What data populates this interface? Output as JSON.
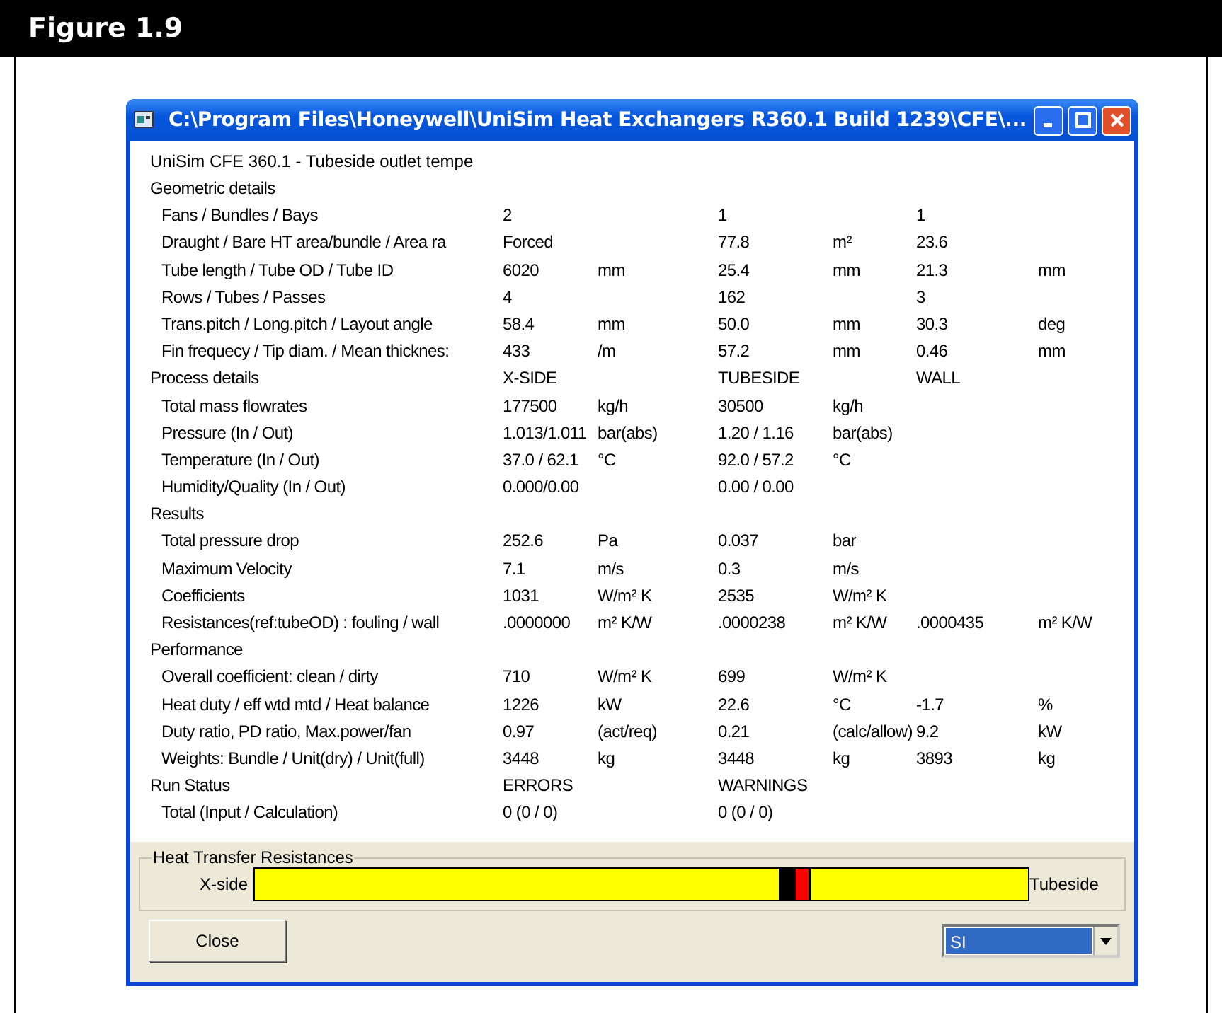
{
  "figure": {
    "label": "Figure 1.9"
  },
  "window": {
    "title": "C:\\Program Files\\Honeywell\\UniSim Heat Exchangers R360.1 Build 1239\\CFE\\..."
  },
  "heading": "UniSim CFE 360.1 - Tubeside outlet tempe",
  "rows": [
    {
      "kind": "section",
      "label": "Geometric details",
      "cells": [
        null,
        null,
        null,
        null,
        null,
        null
      ]
    },
    {
      "kind": "row",
      "label": "Fans / Bundles / Bays",
      "cells": [
        "2",
        null,
        "1",
        null,
        "1",
        null
      ]
    },
    {
      "kind": "row",
      "label": "Draught / Bare HT area/bundle / Area ra",
      "cells": [
        "Forced",
        null,
        "77.8",
        "m²",
        "23.6",
        null
      ]
    },
    {
      "kind": "row",
      "label": "Tube length / Tube OD / Tube ID",
      "cells": [
        "6020",
        "mm",
        "25.4",
        "mm",
        "21.3",
        "mm"
      ]
    },
    {
      "kind": "row",
      "label": "Rows / Tubes / Passes",
      "cells": [
        "4",
        null,
        "162",
        null,
        "3",
        null
      ]
    },
    {
      "kind": "row",
      "label": "Trans.pitch / Long.pitch / Layout angle",
      "cells": [
        "58.4",
        "mm",
        "50.0",
        "mm",
        "30.3",
        "deg"
      ]
    },
    {
      "kind": "row",
      "label": "Fin frequecy / Tip diam. / Mean thicknes:",
      "cells": [
        "433",
        "/m",
        "57.2",
        "mm",
        "0.46",
        "mm"
      ]
    },
    {
      "kind": "section",
      "label": "Process details",
      "cells": [
        "X-SIDE",
        null,
        "TUBESIDE",
        null,
        "WALL",
        null
      ]
    },
    {
      "kind": "row",
      "label": "Total mass flowrates",
      "cells": [
        "177500",
        "kg/h",
        "30500",
        "kg/h",
        null,
        null
      ]
    },
    {
      "kind": "row",
      "label": "Pressure (In / Out)",
      "cells": [
        "1.013/1.011",
        "bar(abs)",
        "1.20 / 1.16",
        "bar(abs)",
        null,
        null
      ]
    },
    {
      "kind": "row",
      "label": "Temperature (In / Out)",
      "cells": [
        "37.0 / 62.1",
        "°C",
        "92.0 / 57.2",
        "°C",
        null,
        null
      ]
    },
    {
      "kind": "row",
      "label": "Humidity/Quality (In / Out)",
      "cells": [
        "0.000/0.00",
        null,
        "0.00 / 0.00",
        null,
        null,
        null
      ]
    },
    {
      "kind": "section",
      "label": "Results",
      "cells": [
        null,
        null,
        null,
        null,
        null,
        null
      ]
    },
    {
      "kind": "row",
      "label": "Total pressure drop",
      "cells": [
        "252.6",
        "Pa",
        "0.037",
        "bar",
        null,
        null
      ]
    },
    {
      "kind": "row",
      "label": "Maximum Velocity",
      "cells": [
        "7.1",
        "m/s",
        "0.3",
        "m/s",
        null,
        null
      ]
    },
    {
      "kind": "row",
      "label": "Coefficients",
      "cells": [
        "1031",
        "W/m² K",
        "2535",
        "W/m² K",
        null,
        null
      ]
    },
    {
      "kind": "row",
      "label": "Resistances(ref:tubeOD) : fouling / wall",
      "cells": [
        ".0000000",
        "m² K/W",
        ".0000238",
        "m² K/W",
        ".0000435",
        "m² K/W"
      ]
    },
    {
      "kind": "section",
      "label": "Performance",
      "cells": [
        null,
        null,
        null,
        null,
        null,
        null
      ]
    },
    {
      "kind": "row",
      "label": "Overall coefficient: clean / dirty",
      "cells": [
        "710",
        "W/m² K",
        "699",
        "W/m² K",
        null,
        null
      ]
    },
    {
      "kind": "row",
      "label": "Heat duty / eff wtd mtd / Heat balance",
      "cells": [
        "1226",
        "kW",
        "22.6",
        "°C",
        "-1.7",
        "%"
      ]
    },
    {
      "kind": "row",
      "label": "Duty ratio, PD ratio, Max.power/fan",
      "cells": [
        "0.97",
        "(act/req)",
        "0.21",
        "(calc/allow)",
        "9.2",
        "kW"
      ]
    },
    {
      "kind": "row",
      "label": "Weights: Bundle / Unit(dry) / Unit(full)",
      "cells": [
        "3448",
        "kg",
        "3448",
        "kg",
        "3893",
        "kg"
      ]
    },
    {
      "kind": "section",
      "label": "Run Status",
      "cells": [
        "ERRORS",
        null,
        "WARNINGS",
        null,
        null,
        null
      ]
    },
    {
      "kind": "row",
      "label": "Total (Input / Calculation)",
      "cells": [
        "0  (0 / 0)",
        null,
        "0  (0 / 0)",
        null,
        null,
        null
      ]
    }
  ],
  "resistances": {
    "title": "Heat Transfer Resistances",
    "left_label": "X-side",
    "right_label": "Tubeside"
  },
  "close_button": "Close",
  "units": {
    "value": "SI"
  }
}
